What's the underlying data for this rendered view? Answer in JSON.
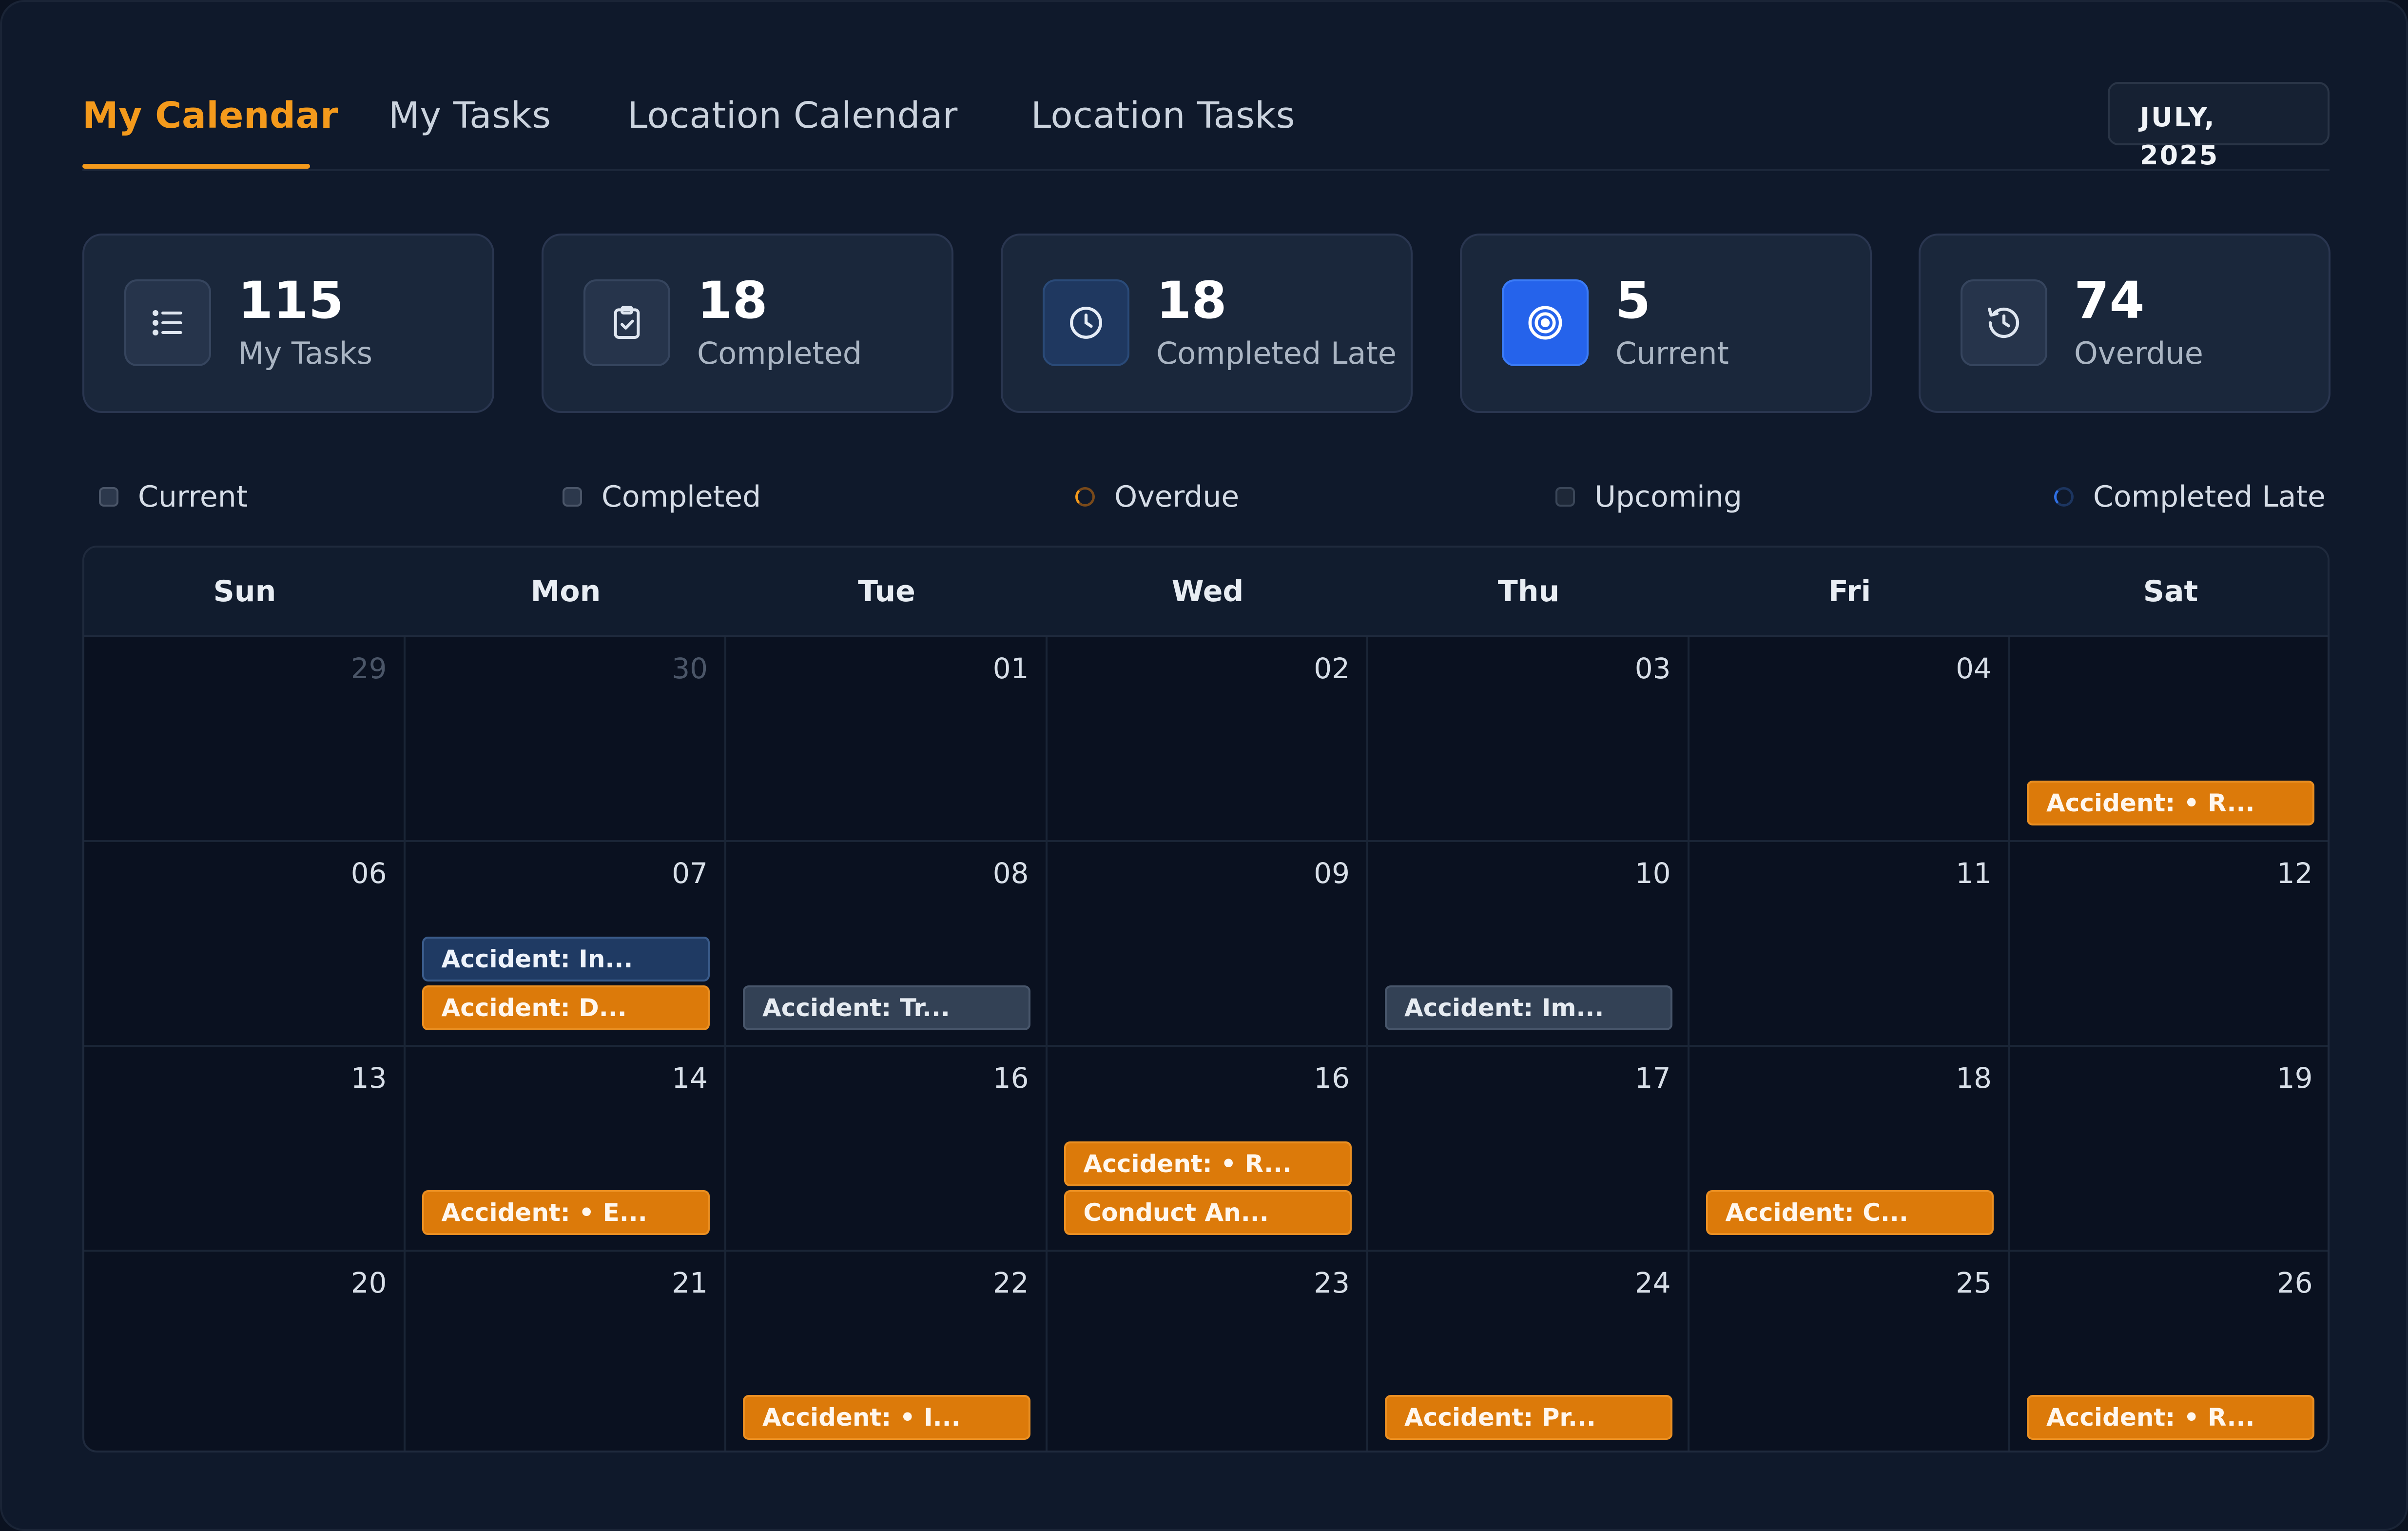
{
  "tabs": [
    {
      "label": "My Calendar",
      "active": true
    },
    {
      "label": "My Tasks",
      "active": false
    },
    {
      "label": "Location Calendar",
      "active": false
    },
    {
      "label": "Location Tasks",
      "active": false
    }
  ],
  "month_picker": {
    "value": "JULY, 2025"
  },
  "stats": [
    {
      "value": "115",
      "label": "My Tasks",
      "icon": "list-icon"
    },
    {
      "value": "18",
      "label": "Completed",
      "icon": "clipboard-check-icon"
    },
    {
      "value": "18",
      "label": "Completed Late",
      "icon": "clock-icon"
    },
    {
      "value": "5",
      "label": "Current",
      "icon": "target-icon"
    },
    {
      "value": "74",
      "label": "Overdue",
      "icon": "history-icon"
    }
  ],
  "legend": [
    {
      "label": "Current"
    },
    {
      "label": "Completed"
    },
    {
      "label": "Overdue"
    },
    {
      "label": "Upcoming"
    },
    {
      "label": "Completed Late"
    }
  ],
  "calendar": {
    "weekdays": [
      "Sun",
      "Mon",
      "Tue",
      "Wed",
      "Thu",
      "Fri",
      "Sat"
    ],
    "weeks": [
      [
        {
          "day": "29",
          "muted": true,
          "events": []
        },
        {
          "day": "30",
          "muted": true,
          "events": []
        },
        {
          "day": "01",
          "events": []
        },
        {
          "day": "02",
          "events": []
        },
        {
          "day": "03",
          "events": []
        },
        {
          "day": "04",
          "events": []
        },
        {
          "day": "",
          "events": [
            {
              "label": "Accident: • R...",
              "style": "orange"
            }
          ]
        }
      ],
      [
        {
          "day": "06",
          "events": []
        },
        {
          "day": "07",
          "events": [
            {
              "label": "Accident: In...",
              "style": "navy"
            },
            {
              "label": "Accident: D...",
              "style": "orange"
            }
          ]
        },
        {
          "day": "08",
          "events": [
            {
              "label": "Accident: Tr...",
              "style": "slate"
            }
          ]
        },
        {
          "day": "09",
          "events": []
        },
        {
          "day": "10",
          "events": [
            {
              "label": "Accident: Im...",
              "style": "slate"
            }
          ]
        },
        {
          "day": "11",
          "events": []
        },
        {
          "day": "12",
          "events": []
        }
      ],
      [
        {
          "day": "13",
          "events": []
        },
        {
          "day": "14",
          "events": [
            {
              "label": "Accident: • E...",
              "style": "orange"
            }
          ]
        },
        {
          "day": "16",
          "events": []
        },
        {
          "day": "16",
          "events": [
            {
              "label": "Accident: • R...",
              "style": "orange"
            },
            {
              "label": "Conduct An...",
              "style": "orange"
            }
          ]
        },
        {
          "day": "17",
          "events": []
        },
        {
          "day": "18",
          "events": [
            {
              "label": "Accident: C...",
              "style": "orange"
            }
          ]
        },
        {
          "day": "19",
          "events": []
        }
      ],
      [
        {
          "day": "20",
          "events": []
        },
        {
          "day": "21",
          "events": []
        },
        {
          "day": "22",
          "events": [
            {
              "label": "Accident: • I...",
              "style": "orange"
            }
          ]
        },
        {
          "day": "23",
          "events": []
        },
        {
          "day": "24",
          "events": [
            {
              "label": "Accident: Pr...",
              "style": "orange"
            }
          ]
        },
        {
          "day": "25",
          "events": []
        },
        {
          "day": "26",
          "events": [
            {
              "label": "Accident: • R...",
              "style": "orange"
            }
          ]
        }
      ]
    ]
  },
  "colors": {
    "accent": "#f49a1c",
    "event_orange": "#dc7a0a",
    "event_navy": "#1f3a63",
    "event_slate": "#334155",
    "current_blue": "#2563eb"
  }
}
